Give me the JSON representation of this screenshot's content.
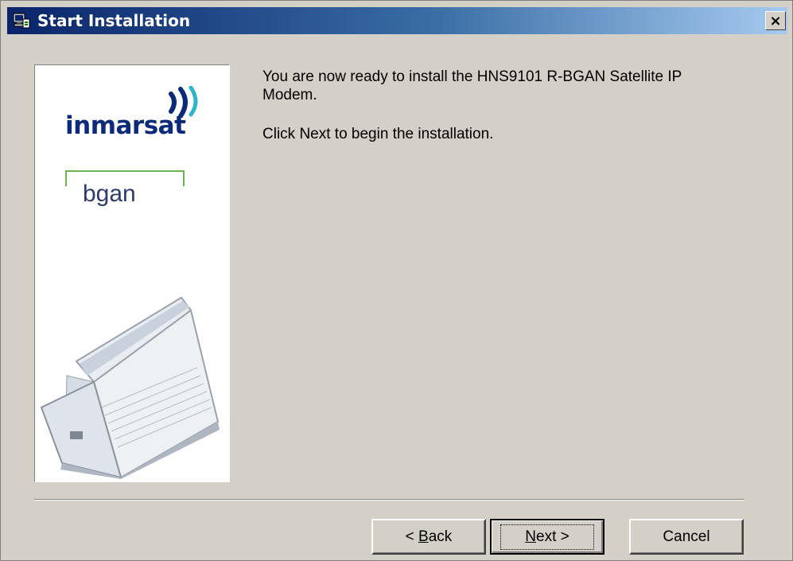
{
  "window": {
    "title": "Start Installation",
    "close_label": "×"
  },
  "side_panel": {
    "brand": "inmarsat",
    "product": "bgan"
  },
  "message": {
    "line1": "You are now ready to install the HNS9101 R-BGAN Satellite IP",
    "line2": "Modem.",
    "line3": "Click Next to begin the installation."
  },
  "buttons": {
    "back_prefix": "< ",
    "back_accel": "B",
    "back_rest": "ack",
    "next_accel": "N",
    "next_rest": "ext >",
    "cancel": "Cancel"
  },
  "colors": {
    "titlebar_start": "#0a246a",
    "titlebar_end": "#a6caf0",
    "brand_blue": "#0b2a7a",
    "brand_green": "#6bb34a",
    "dialog_bg": "#d4d0c8"
  }
}
